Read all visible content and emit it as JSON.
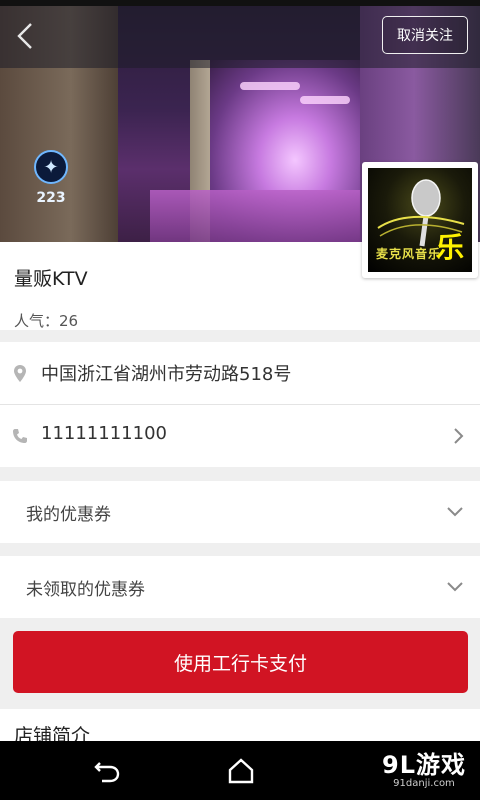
{
  "header": {
    "back_icon": "chevron-left-icon",
    "follow_label": "取消关注"
  },
  "hero": {
    "sign_number": "223"
  },
  "shop": {
    "name": "量贩KTV",
    "popularity": "人气：26",
    "logo_text": "麦克风音乐",
    "logo_big_char": "乐"
  },
  "contact": {
    "address": "中国浙江省湖州市劳动路518号",
    "address_icon": "location-pin-icon",
    "phone": "11111111100",
    "phone_icon": "phone-icon"
  },
  "coupons": {
    "mine_label": "我的优惠券",
    "unclaimed_label": "未领取的优惠券"
  },
  "pay": {
    "label": "使用工行卡支付"
  },
  "intro": {
    "title": "店铺简介"
  },
  "navbar": {
    "watermark_main": "9L游戏",
    "watermark_sub": "91danji.com"
  },
  "colors": {
    "accent": "#d11423",
    "background": "#efefef",
    "card": "#ffffff"
  }
}
